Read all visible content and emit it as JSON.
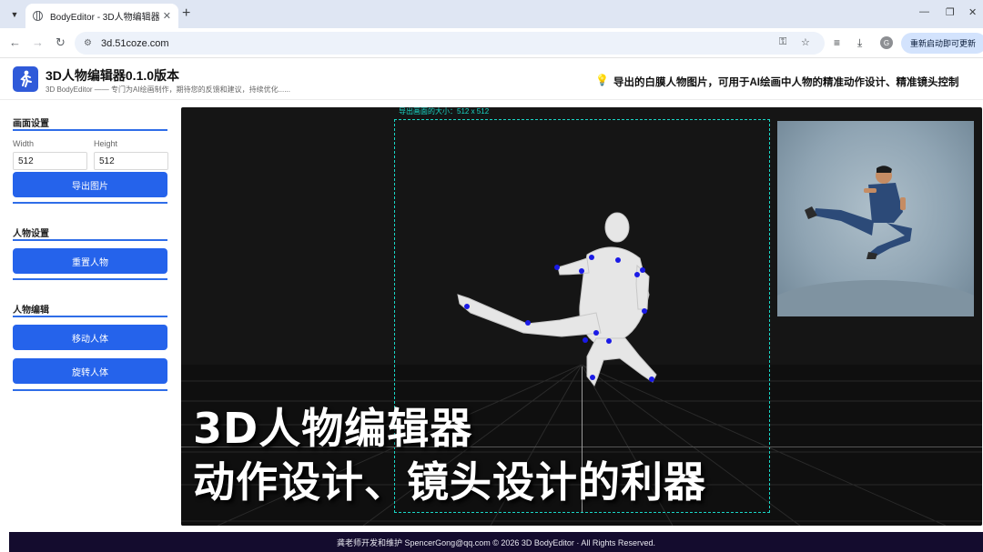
{
  "browser": {
    "tab_title": "BodyEditor - 3D人物编辑器",
    "url": "3d.51coze.com",
    "update_label": "重新启动即可更新",
    "profile_initial": "G"
  },
  "header": {
    "title": "3D人物编辑器0.1.0版本",
    "subtitle": "3D BodyEditor —— 专门为AI绘画制作，期待您的反馈和建议，持续优化......",
    "tip": "导出的白膜人物图片，可用于AI绘画中人物的精准动作设计、精准镜头控制"
  },
  "sidebar": {
    "canvas_section": "画面设置",
    "width_label": "Width",
    "height_label": "Height",
    "width_value": "512",
    "height_value": "512",
    "export_button": "导出图片",
    "figure_section": "人物设置",
    "reset_button": "重置人物",
    "edit_section": "人物编辑",
    "move_button": "移动人体",
    "rotate_button": "旋转人体"
  },
  "stage": {
    "export_size_label": "导出画面的大小：512 x 512",
    "overlay_line1": "3D人物编辑器",
    "overlay_line2": "动作设计、镜头设计的利器",
    "joint_color": "#0000ee",
    "guide_color": "#19d6c6"
  },
  "footer": {
    "text": "龚老师开发和维护 SpencerGong@qq.com © 2026 3D BodyEditor · All Rights Reserved."
  }
}
